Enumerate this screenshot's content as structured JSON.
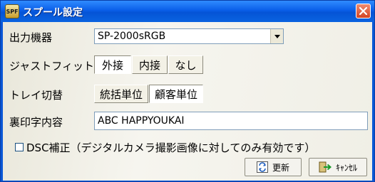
{
  "window": {
    "title": "スプール設定",
    "icon_text": "SPF"
  },
  "printer": {
    "label": "出力機器",
    "selected": "SP-2000sRGB"
  },
  "justfit": {
    "label": "ジャストフィット",
    "options": [
      "外接",
      "内接",
      "なし"
    ]
  },
  "tray": {
    "label": "トレイ切替",
    "options": [
      "統括単位",
      "顧客単位"
    ]
  },
  "backprint": {
    "label": "裏印字内容",
    "value": "ABC HAPPYOUKAI"
  },
  "dsc": {
    "label": "DSC補正（デジタルカメラ撮影画像に対してのみ有効です）",
    "checked": false
  },
  "actions": {
    "update": "更新",
    "cancel": "ｷｬﾝｾﾙ"
  },
  "colors": {
    "titlebar": "#0a5ee8",
    "client": "#f0efe6",
    "close": "#d44423"
  }
}
